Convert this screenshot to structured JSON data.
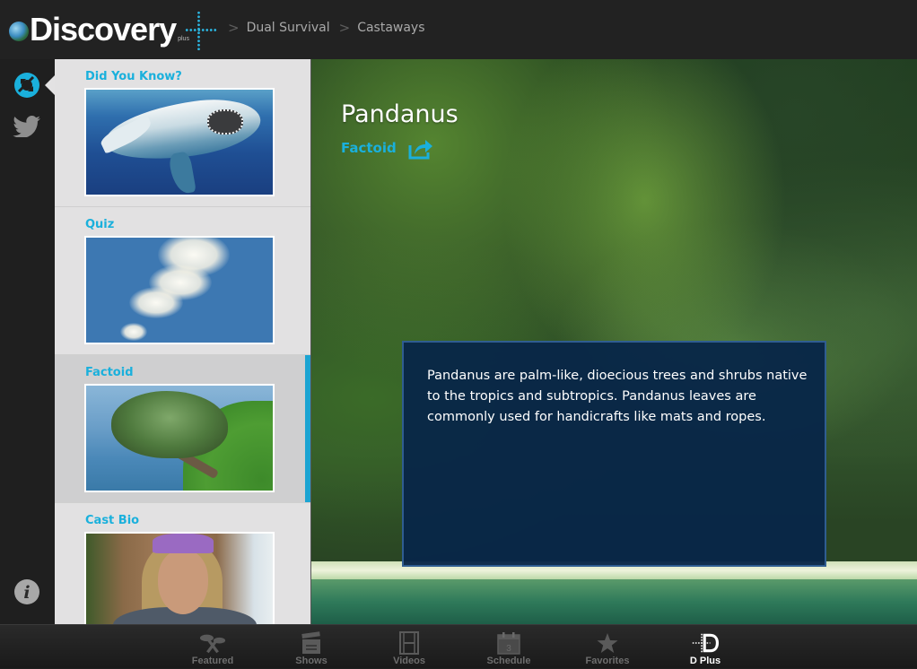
{
  "header": {
    "logo_text": "Discovery",
    "logo_sub": "plus",
    "breadcrumb": [
      "Dual Survival",
      "Castaways"
    ]
  },
  "rail": {
    "items": [
      {
        "name": "refresh",
        "active": true
      },
      {
        "name": "twitter",
        "active": false
      }
    ],
    "info_icon": "i"
  },
  "cards": [
    {
      "title": "Did You Know?",
      "image": "shark",
      "selected": false
    },
    {
      "title": "Quiz",
      "image": "sky-clouds",
      "selected": false
    },
    {
      "title": "Factoid",
      "image": "pandanus-tree",
      "selected": true
    },
    {
      "title": "Cast Bio",
      "image": "cast-member-portrait",
      "selected": false
    }
  ],
  "detail": {
    "title": "Pandanus",
    "category": "Factoid",
    "body": "Pandanus are palm-like, dioecious trees and shrubs native to the tropics and subtropics. Pandanus leaves are commonly used for handicrafts like mats and ropes."
  },
  "tabbar": {
    "tabs": [
      {
        "label": "Featured",
        "icon": "featured-icon",
        "active": false
      },
      {
        "label": "Shows",
        "icon": "clapperboard-icon",
        "active": false
      },
      {
        "label": "Videos",
        "icon": "film-strip-icon",
        "active": false
      },
      {
        "label": "Schedule",
        "icon": "calendar-icon",
        "active": false,
        "icon_text": "3"
      },
      {
        "label": "Favorites",
        "icon": "star-icon",
        "active": false
      },
      {
        "label": "D Plus",
        "icon": "dplus-icon",
        "active": true
      }
    ]
  },
  "colors": {
    "accent": "#1ab0dc",
    "fact_box": "#08264a",
    "topbar": "#222222"
  }
}
